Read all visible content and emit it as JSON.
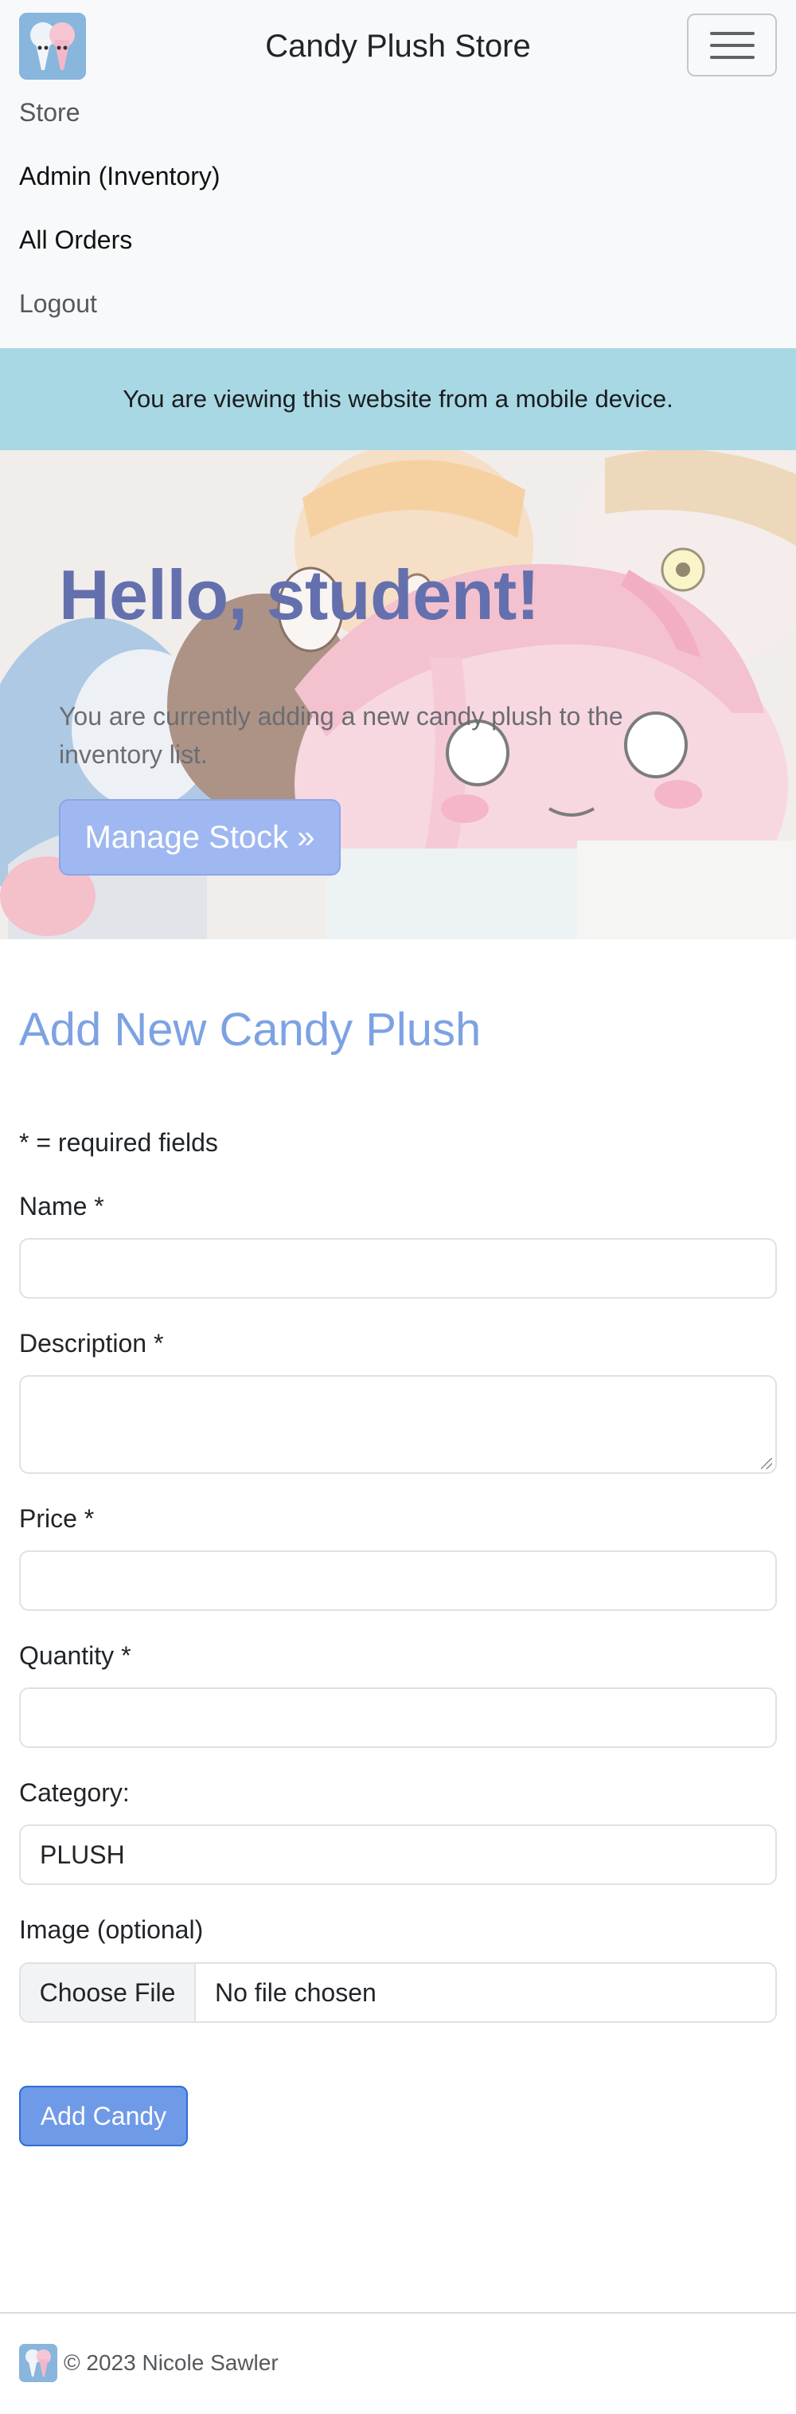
{
  "navbar": {
    "brand_title": "Candy Plush Store",
    "links": [
      {
        "label": "Store"
      },
      {
        "label": "Admin (Inventory)"
      },
      {
        "label": "All Orders"
      },
      {
        "label": "Logout"
      }
    ]
  },
  "alert": {
    "message": "You are viewing this website from a mobile device."
  },
  "hero": {
    "title": "Hello, student!",
    "text": "You are currently adding a new candy plush to the inventory list.",
    "button_label": "Manage Stock »"
  },
  "form": {
    "title": "Add New Candy Plush",
    "required_note": "* = required fields",
    "name_label": "Name *",
    "name_value": "",
    "description_label": "Description *",
    "description_value": "",
    "price_label": "Price *",
    "price_value": "",
    "quantity_label": "Quantity *",
    "quantity_value": "",
    "category_label": "Category:",
    "category_value": "PLUSH",
    "image_label": "Image (optional)",
    "file_button_label": "Choose File",
    "file_status": "No file chosen",
    "submit_label": "Add Candy"
  },
  "footer": {
    "text": "© 2023 Nicole Sawler"
  },
  "colors": {
    "navbar_bg": "#f8f9fa",
    "alert_bg": "#a8d8e3",
    "hero_title": "#6470ad",
    "form_title": "#7da2e3",
    "primary_button": "#6f9ae8"
  },
  "icons": {
    "brand_logo": "cotton-candy-logo-icon",
    "menu": "hamburger-menu-icon"
  }
}
